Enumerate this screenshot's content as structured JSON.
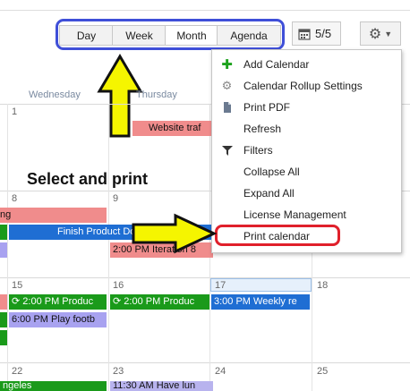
{
  "toolbar": {
    "views": [
      "Day",
      "Week",
      "Month",
      "Agenda"
    ],
    "active_view": "Month",
    "date_label": "5/5"
  },
  "calendar": {
    "headers": [
      "Wednesday",
      "Thursday"
    ],
    "day_numbers": [
      "1",
      "8",
      "9",
      "15",
      "16",
      "17",
      "18",
      "22",
      "23",
      "24",
      "25"
    ],
    "events": {
      "website": "Website traf",
      "ng": "ng",
      "finish": "Finish Product Do",
      "iteration": "2:00 PM Iteration 8",
      "p15": "2:00 PM Produc",
      "play": "6:00 PM Play footb",
      "p16": "2:00 PM Produc",
      "weekly": "3:00 PM Weekly re",
      "ngeles": "ngeles",
      "lunch": "11:30 AM Have lun"
    }
  },
  "menu": {
    "items": [
      {
        "label": "Add Calendar",
        "icon": "plus-icon"
      },
      {
        "label": "Calendar Rollup Settings",
        "icon": "gear-icon"
      },
      {
        "label": "Print PDF",
        "icon": "document-icon"
      },
      {
        "label": "Refresh",
        "icon": ""
      },
      {
        "label": "Filters",
        "icon": "filter-icon"
      },
      {
        "label": "Collapse All",
        "icon": ""
      },
      {
        "label": "Expand All",
        "icon": ""
      },
      {
        "label": "License Management",
        "icon": ""
      },
      {
        "label": "Print calendar",
        "icon": ""
      }
    ]
  },
  "annotation": {
    "text": "Select and print"
  },
  "colors": {
    "highlight_blue": "#3f4fd8",
    "highlight_red": "#e0202b",
    "arrow_yellow": "#f5f500"
  }
}
